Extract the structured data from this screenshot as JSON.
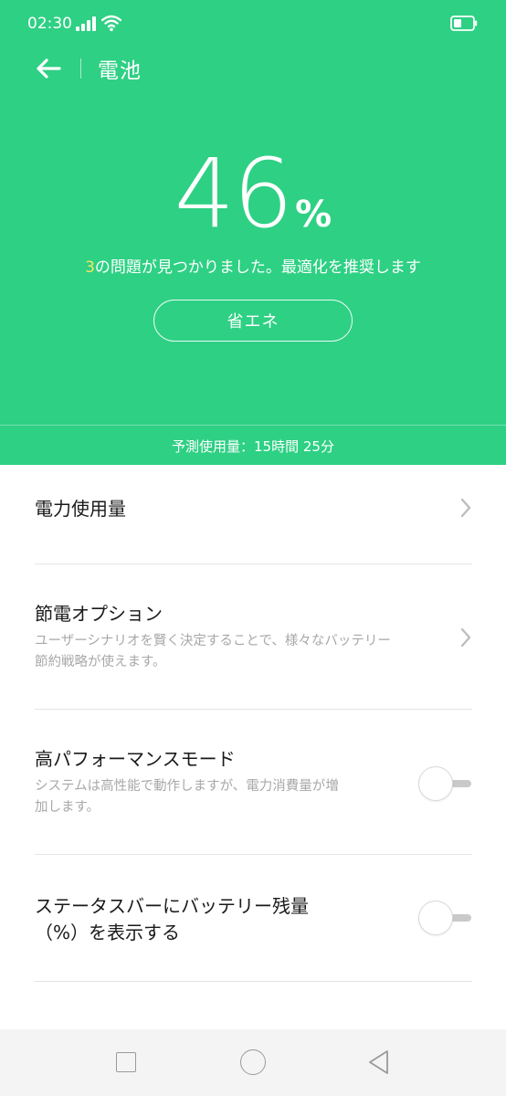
{
  "status_bar": {
    "time": "02:30"
  },
  "header": {
    "title": "電池"
  },
  "battery": {
    "percent": "46",
    "unit": "%",
    "issue_count": "3",
    "issue_text": "の問題が見つかりました。最適化を推奨します",
    "save_button_label": "省エネ",
    "estimate": "予測使用量：15時間 25分"
  },
  "settings": {
    "power_usage": {
      "title": "電力使用量"
    },
    "power_saving_options": {
      "title": "節電オプション",
      "subtitle_line1": "ユーザーシナリオを賢く決定することで、様々なバッテリー",
      "subtitle_line2": "節約戦略が使えます。"
    },
    "high_performance_mode": {
      "title": "高パフォーマンスモード",
      "subtitle_line1": "システムは高性能で動作しますが、電力消費量が増",
      "subtitle_line2": "加します。",
      "enabled": false
    },
    "status_bar_percentage": {
      "title_line1": "ステータスバーにバッテリー残量",
      "title_line2": "（%）を表示する",
      "enabled": false
    }
  },
  "colors": {
    "accent": "#2ed084",
    "issue_highlight": "#f5e663"
  },
  "icons": {
    "back": "back-arrow-icon",
    "chevron": "chevron-right-icon",
    "signal": "signal-icon",
    "wifi": "wifi-icon",
    "battery": "battery-icon"
  }
}
